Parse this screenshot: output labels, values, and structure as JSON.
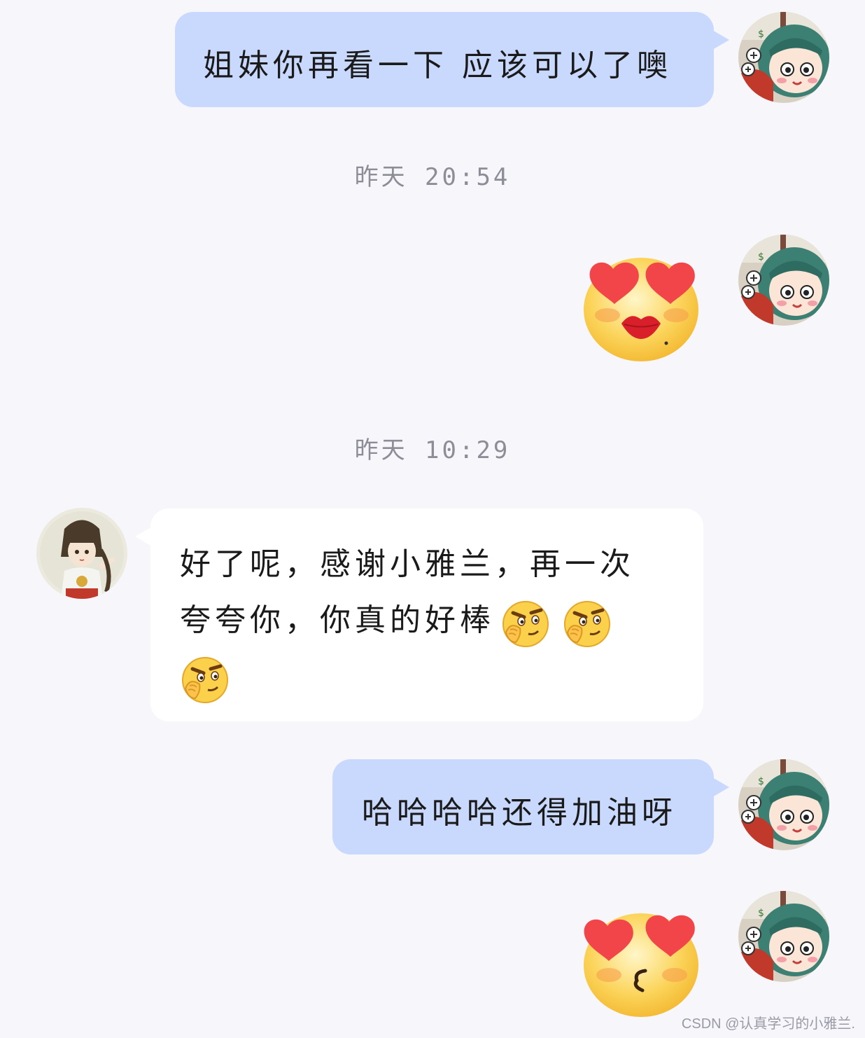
{
  "colors": {
    "background": "#f6f6fb",
    "outgoing_bubble": "#c9d8fd",
    "incoming_bubble": "#ffffff",
    "timestamp_text": "#8d8d98"
  },
  "messages": [
    {
      "direction": "outgoing",
      "text": "姐妹你再看一下 应该可以了噢",
      "avatar": "cartoon-girl-green-hair-avatar"
    },
    {
      "direction": "timestamp",
      "text": "昨天 20:54"
    },
    {
      "direction": "outgoing",
      "sticker": "heart-eyes-kiss-lips-emoji",
      "avatar": "cartoon-girl-green-hair-avatar"
    },
    {
      "direction": "timestamp",
      "text": "昨天 10:29"
    },
    {
      "direction": "incoming",
      "line1": "好了呢，感谢小雅兰，再一次",
      "line2": "夸夸你，你真的好棒",
      "emoji": "smirk-thinking-emoji",
      "emoji_count": 3,
      "avatar": "anime-girl-avatar"
    },
    {
      "direction": "outgoing",
      "text": "哈哈哈哈还得加油呀",
      "avatar": "cartoon-girl-green-hair-avatar"
    },
    {
      "direction": "outgoing",
      "sticker": "heart-eyes-kissing-emoji",
      "avatar": "cartoon-girl-green-hair-avatar"
    }
  ],
  "watermark": "CSDN @认真学习的小雅兰."
}
